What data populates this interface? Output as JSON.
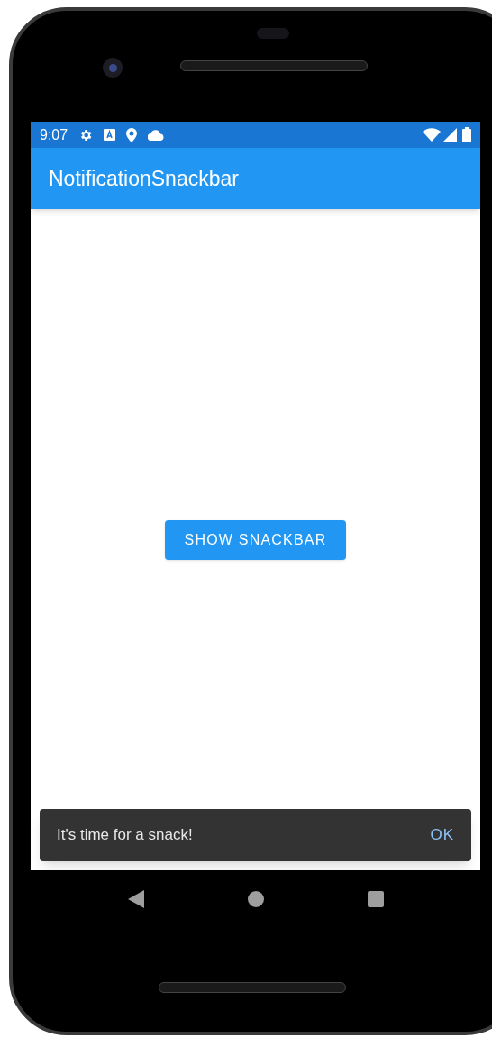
{
  "status_bar": {
    "time": "9:07"
  },
  "app_bar": {
    "title": "NotificationSnackbar"
  },
  "content": {
    "button": "SHOW SNACKBAR"
  },
  "snackbar": {
    "message": "It's time for a snack!",
    "action": "OK"
  }
}
